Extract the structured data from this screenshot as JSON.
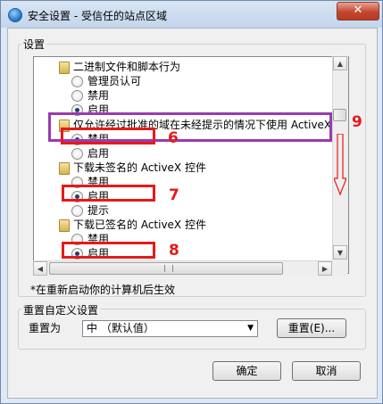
{
  "window": {
    "title": "安全设置 - 受信任的站点区域",
    "close_glyph": "✕"
  },
  "settings_group": {
    "legend": "设置",
    "items": [
      {
        "kind": "folder",
        "label": "二进制文件和脚本行为"
      },
      {
        "kind": "radio",
        "label": "管理员认可",
        "selected": false
      },
      {
        "kind": "radio",
        "label": "禁用",
        "selected": false
      },
      {
        "kind": "radio",
        "label": "启用",
        "selected": true
      },
      {
        "kind": "folder",
        "label": "仅允许经过批准的域在未经提示的情况下使用 ActiveX"
      },
      {
        "kind": "radio",
        "label": "禁用",
        "selected": true
      },
      {
        "kind": "radio",
        "label": "启用",
        "selected": false
      },
      {
        "kind": "folder",
        "label": "下载未签名的 ActiveX 控件"
      },
      {
        "kind": "radio",
        "label": "禁用",
        "selected": false
      },
      {
        "kind": "radio",
        "label": "启用",
        "selected": true
      },
      {
        "kind": "radio",
        "label": "提示",
        "selected": false
      },
      {
        "kind": "folder",
        "label": "下载已签名的 ActiveX 控件"
      },
      {
        "kind": "radio",
        "label": "禁用",
        "selected": false
      },
      {
        "kind": "radio",
        "label": "启用",
        "selected": true
      }
    ],
    "note": "*在重新启动你的计算机后生效"
  },
  "reset_group": {
    "legend": "重置自定义设置",
    "reset_to_label": "重置为",
    "level_value": "中 （默认值）",
    "reset_button": "重置(E)..."
  },
  "footer": {
    "ok_button": "确定",
    "cancel_button": "取消"
  },
  "annotations": {
    "numbers": [
      "6",
      "7",
      "8",
      "9"
    ],
    "red_color": "#e51a1a",
    "purple_color": "#9b3ab0"
  }
}
